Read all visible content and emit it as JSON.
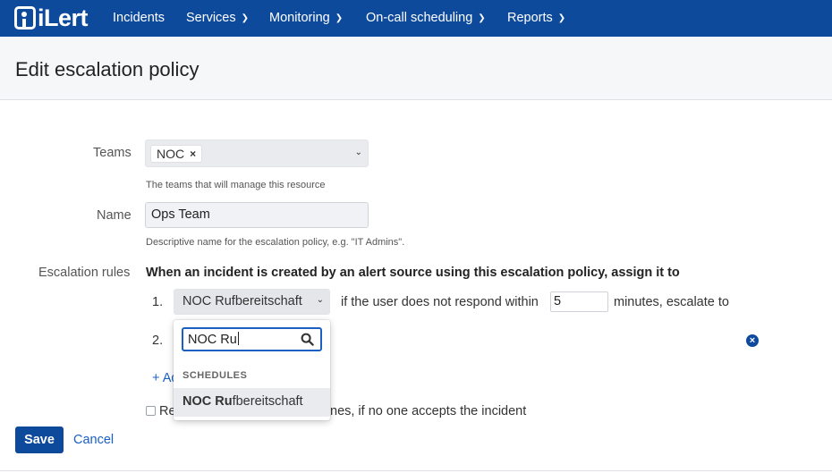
{
  "app": {
    "logo_text": "iLert"
  },
  "nav": {
    "items": [
      {
        "label": "Incidents",
        "has_menu": false
      },
      {
        "label": "Services",
        "has_menu": true
      },
      {
        "label": "Monitoring",
        "has_menu": true
      },
      {
        "label": "On-call scheduling",
        "has_menu": true
      },
      {
        "label": "Reports",
        "has_menu": true
      }
    ]
  },
  "page": {
    "title": "Edit escalation policy"
  },
  "form": {
    "teams": {
      "label": "Teams",
      "selected_chip": "NOC",
      "chip_remove": "×",
      "help": "The teams that will manage this resource"
    },
    "name": {
      "label": "Name",
      "value": "Ops Team",
      "help": "Descriptive name for the escalation policy, e.g. \"IT Admins\"."
    },
    "escalation": {
      "label": "Escalation rules",
      "title": "When an incident is created by an alert source using this escalation policy, assign it to",
      "rules": [
        {
          "index": "1.",
          "assignee": "NOC Rufbereitschaft",
          "condition_text": "if the user does not respond within",
          "minutes": "5",
          "suffix_text": "minutes, escalate to"
        },
        {
          "index": "2."
        }
      ],
      "add_link": "+ Ad",
      "repeat_checkbox_prefix": "Re",
      "repeat_checkbox_suffix": "nes, if no one accepts the incident"
    }
  },
  "dropdown": {
    "search_value": "NOC Ru",
    "group_label": "SCHEDULES",
    "options": [
      {
        "match": "NOC Ru",
        "rest": "fbereitschaft",
        "highlighted": true
      }
    ]
  },
  "actions": {
    "save_label": "Save",
    "cancel_label": "Cancel"
  },
  "colors": {
    "nav_background": "#0d4a9c",
    "link": "#1a5fc4",
    "primary_button": "#0d4a9c"
  }
}
